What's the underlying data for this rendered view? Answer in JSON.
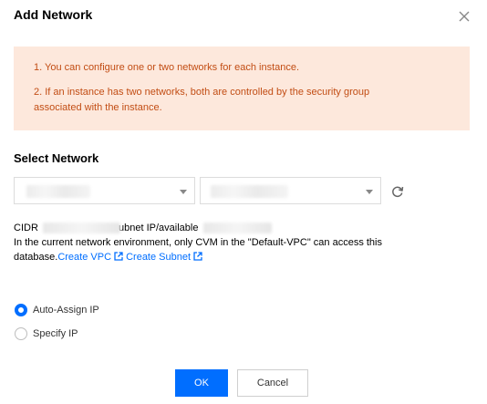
{
  "dialog": {
    "title": "Add Network",
    "close_icon": "close-icon"
  },
  "notice": {
    "line1": "1. You can configure one or two networks for each instance.",
    "line2": "2. If an instance has two networks, both are controlled by the security group",
    "line3": "associated with the instance.",
    "background": "#fde8dc",
    "text_color": "#c24d14"
  },
  "network": {
    "section_title": "Select Network",
    "vpc_select_value": "",
    "subnet_select_value": "",
    "refresh_icon": "refresh-icon"
  },
  "info": {
    "cidr_prefix": "CIDR",
    "cidr_suffix": "ubnet IP/available",
    "environment_note": "In the current network environment, only CVM in the \"Default-VPC\" can access this",
    "database_text": "database.",
    "create_vpc": "Create VPC",
    "create_subnet": "Create Subnet"
  },
  "ip_mode": {
    "auto_assign": "Auto-Assign IP",
    "specify": "Specify IP",
    "selected": "Auto-Assign IP"
  },
  "actions": {
    "ok": "OK",
    "cancel": "Cancel"
  },
  "colors": {
    "accent": "#006eff",
    "border": "#dcdcdc"
  }
}
